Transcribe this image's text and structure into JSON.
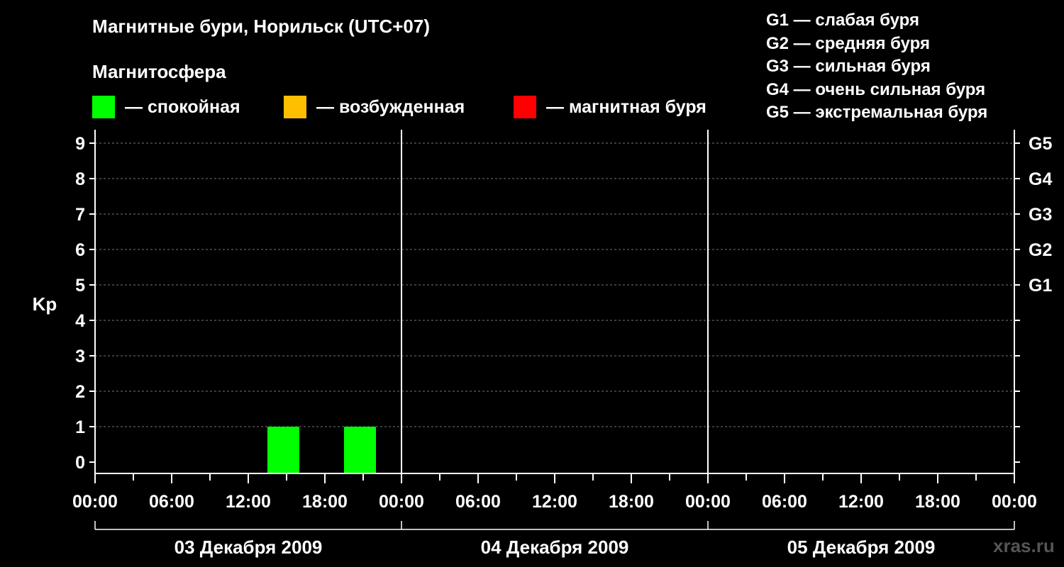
{
  "title": "Магнитные бури, Норильск (UTC+07)",
  "magnetosphere_title": "Магнитосфера",
  "legend": [
    {
      "label": "— спокойная",
      "color": "#00ff00"
    },
    {
      "label": "— возбужденная",
      "color": "#ffbf00"
    },
    {
      "label": "— магнитная буря",
      "color": "#ff0000"
    }
  ],
  "storm_levels": [
    "G1 — слабая буря",
    "G2 — средняя буря",
    "G3 — сильная буря",
    "G4 — очень сильная буря",
    "G5 — экстремальная буря"
  ],
  "watermark": "xras.ru",
  "chart_data": {
    "type": "bar",
    "ylabel": "Kp",
    "ylim": [
      0,
      9
    ],
    "y_ticks": [
      "0",
      "1",
      "2",
      "3",
      "4",
      "5",
      "6",
      "7",
      "8",
      "9"
    ],
    "right_axis_labels": [
      {
        "kp": 5,
        "label": "G1"
      },
      {
        "kp": 6,
        "label": "G2"
      },
      {
        "kp": 7,
        "label": "G3"
      },
      {
        "kp": 8,
        "label": "G4"
      },
      {
        "kp": 9,
        "label": "G5"
      }
    ],
    "x_range_hours": [
      0,
      72
    ],
    "x_tick_labels": [
      "00:00",
      "06:00",
      "12:00",
      "18:00",
      "00:00",
      "06:00",
      "12:00",
      "18:00",
      "00:00",
      "06:00",
      "12:00",
      "18:00",
      "00:00"
    ],
    "days": [
      "03 Декабря 2009",
      "04 Декабря 2009",
      "05 Декабря 2009"
    ],
    "grid": true,
    "bars": [
      {
        "start_hour": 13.5,
        "end_hour": 16.0,
        "kp": 1,
        "color": "#00ff00"
      },
      {
        "start_hour": 19.5,
        "end_hour": 22.0,
        "kp": 1,
        "color": "#00ff00"
      }
    ]
  }
}
